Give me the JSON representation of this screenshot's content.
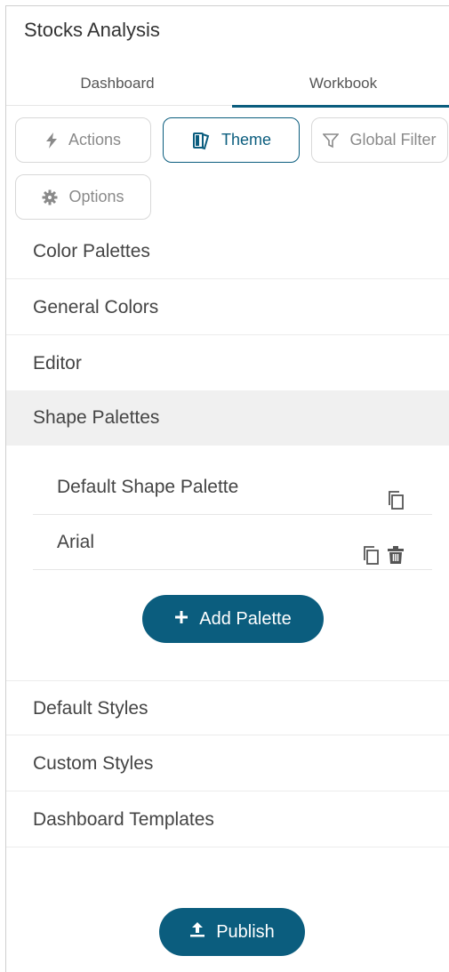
{
  "panel": {
    "title": "Stocks Analysis"
  },
  "tabs": [
    {
      "label": "Dashboard",
      "active": false
    },
    {
      "label": "Workbook",
      "active": true
    }
  ],
  "toolbar": {
    "actions_label": "Actions",
    "theme_label": "Theme",
    "global_filter_label": "Global Filter",
    "options_label": "Options"
  },
  "sections": {
    "color_palettes": "Color Palettes",
    "general_colors": "General Colors",
    "editor": "Editor",
    "shape_palettes": "Shape Palettes",
    "default_styles": "Default Styles",
    "custom_styles": "Custom Styles",
    "dashboard_templates": "Dashboard Templates"
  },
  "shape_palettes": [
    {
      "name": "Default Shape Palette",
      "actions": [
        "copy-icon"
      ]
    },
    {
      "name": "Arial",
      "actions": [
        "copy-icon",
        "trash-icon"
      ]
    }
  ],
  "add_palette_label": "Add Palette",
  "publish_label": "Publish",
  "colors": {
    "accent": "#0b5d7e",
    "active_row": "#f0f0f0"
  }
}
